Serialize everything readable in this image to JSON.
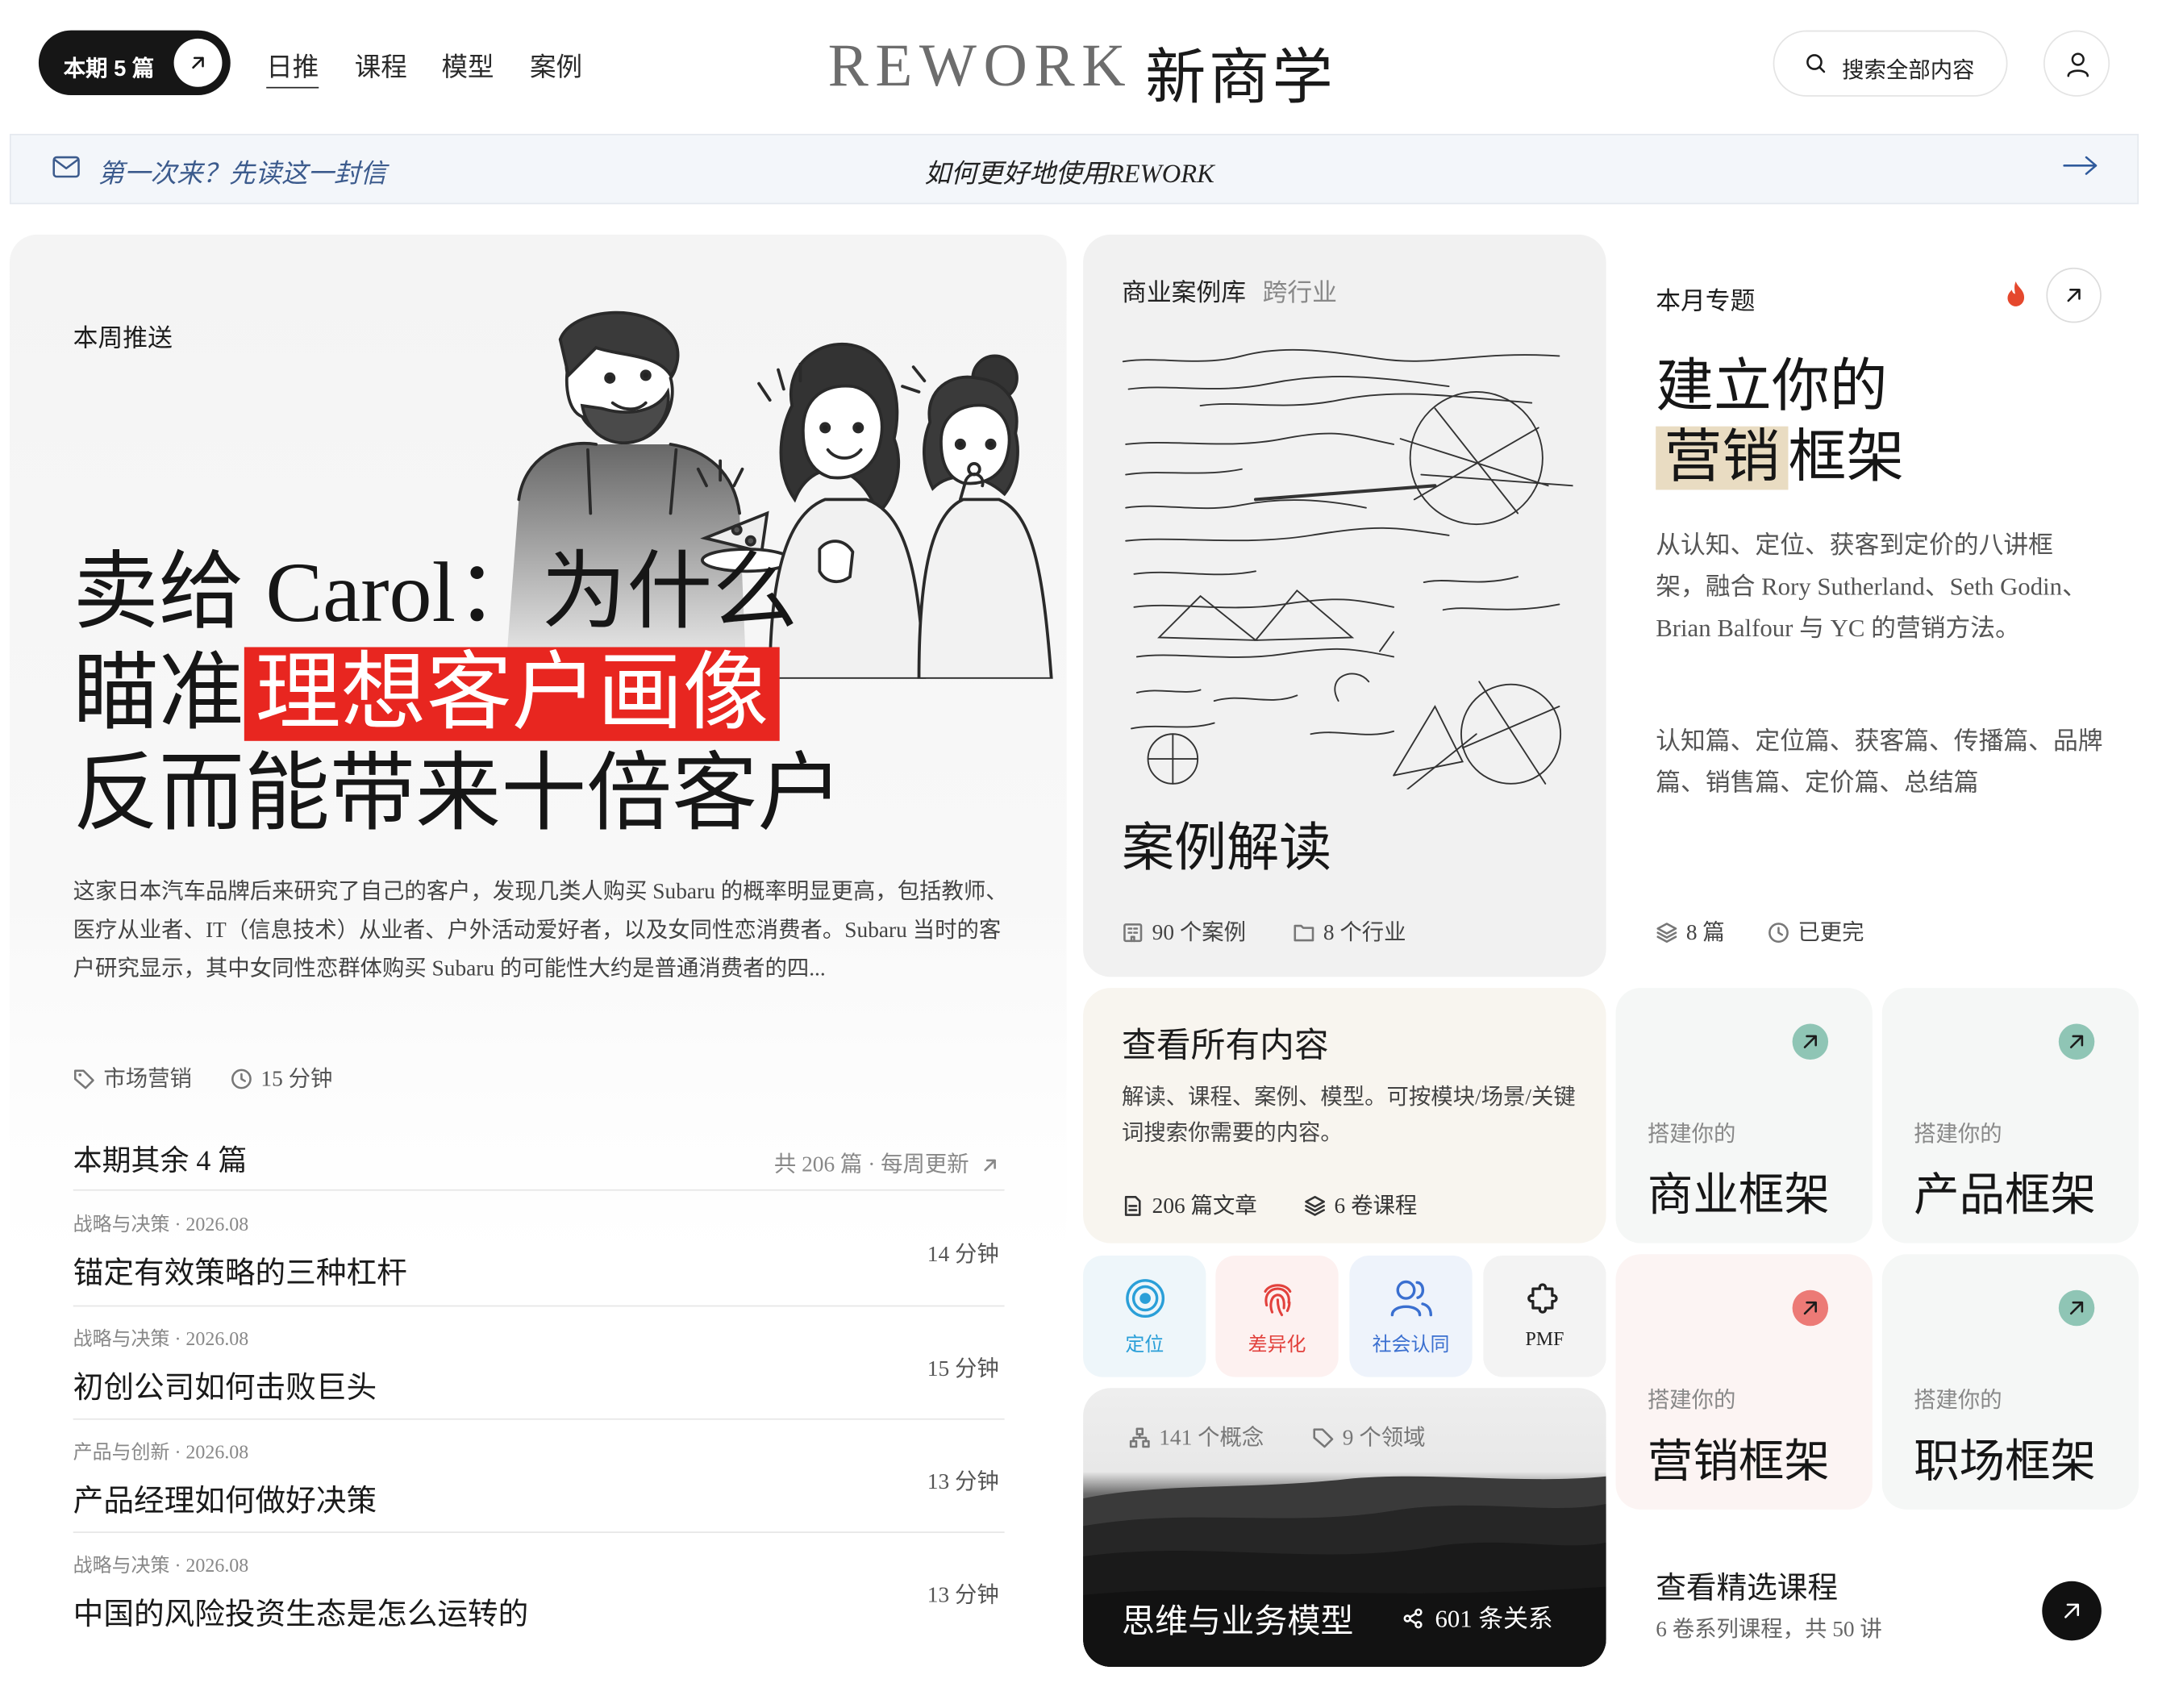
{
  "header": {
    "issue_badge": "本期 5 篇",
    "nav": [
      "日推",
      "课程",
      "模型",
      "案例"
    ],
    "brand_latin": "REWORK",
    "brand_cn": "新商学",
    "search_label": "搜索全部内容"
  },
  "banner": {
    "first_visit": "第一次来？先读这一封信",
    "center": "如何更好地使用REWORK"
  },
  "feature": {
    "label": "本周推送",
    "title_line1": "卖给 Carol：为什么",
    "title_line2_plain": "瞄准",
    "title_line2_highlight": "理想客户画像",
    "title_line3": "反而能带来十倍客户",
    "description": "这家日本汽车品牌后来研究了自己的客户，发现几类人购买 Subaru 的概率明显更高，包括教师、医疗从业者、IT（信息技术）从业者、户外活动爱好者，以及女同性恋消费者。Subaru 当时的客户研究显示，其中女同性恋群体购买 Subaru 的可能性大约是普通消费者的四...",
    "tag": "市场营销",
    "read_time": "15 分钟",
    "rest_title": "本期其余 4 篇",
    "rest_meta": "共 206 篇 · 每周更新",
    "articles": [
      {
        "category": "战略与决策 · 2026.08",
        "title": "锚定有效策略的三种杠杆",
        "minutes": "14 分钟"
      },
      {
        "category": "战略与决策 · 2026.08",
        "title": "初创公司如何击败巨头",
        "minutes": "15 分钟"
      },
      {
        "category": "产品与创新 · 2026.08",
        "title": "产品经理如何做好决策",
        "minutes": "13 分钟"
      },
      {
        "category": "战略与决策 · 2026.08",
        "title": "中国的风险投资生态是怎么运转的",
        "minutes": "13 分钟"
      }
    ]
  },
  "case_library": {
    "label": "商业案例库",
    "sub_label": "跨行业",
    "title": "案例解读",
    "cases": "90 个案例",
    "industries": "8 个行业"
  },
  "topic": {
    "label": "本月专题",
    "title_line1": "建立你的",
    "title_highlight": "营销",
    "title_rest": "框架",
    "description": "从认知、定位、获客到定价的八讲框架，融合 Rory Sutherland、Seth Godin、Brian Balfour 与 YC 的营销方法。",
    "chapters": "认知篇、定位篇、获客篇、传播篇、品牌篇、销售篇、定价篇、总结篇",
    "count": "8 篇",
    "status": "已更完"
  },
  "all_content": {
    "title": "查看所有内容",
    "description": "解读、课程、案例、模型。可按模块/场景/关键词搜索你需要的内容。",
    "articles": "206 篇文章",
    "courses": "6 卷课程"
  },
  "frameworks": [
    {
      "prefix": "搭建你的",
      "name": "商业框架",
      "accent": "#8fc5b5"
    },
    {
      "prefix": "搭建你的",
      "name": "产品框架",
      "accent": "#8fc5b5"
    },
    {
      "prefix": "搭建你的",
      "name": "营销框架",
      "accent": "#ec7a76"
    },
    {
      "prefix": "搭建你的",
      "name": "职场框架",
      "accent": "#8fc5b5"
    }
  ],
  "tags": [
    {
      "label": "定位",
      "icon": "target-icon",
      "color": "#2a9fd8"
    },
    {
      "label": "差异化",
      "icon": "fingerprint-icon",
      "color": "#e2413c"
    },
    {
      "label": "社会认同",
      "icon": "users-icon",
      "color": "#3a6fd0"
    },
    {
      "label": "PMF",
      "icon": "puzzle-icon",
      "color": "#222222"
    }
  ],
  "model": {
    "concepts": "141 个概念",
    "domains": "9 个领域",
    "title": "思维与业务模型",
    "relations": "601 条关系"
  },
  "courses": {
    "title": "查看精选课程",
    "description": "6 卷系列课程，共 50 讲"
  }
}
